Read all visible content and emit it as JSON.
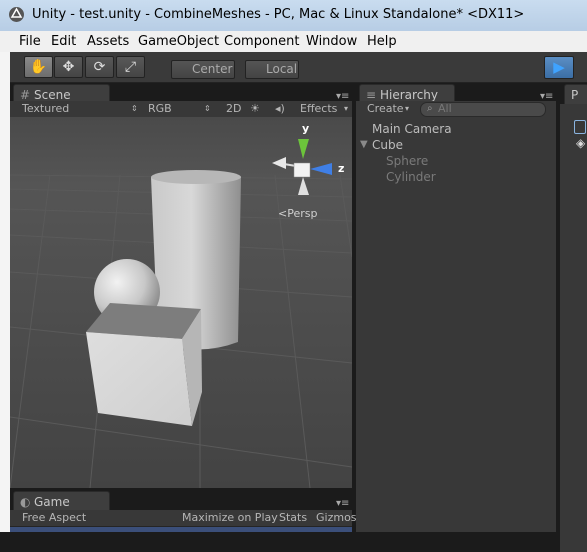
{
  "window": {
    "title": "Unity - test.unity - CombineMeshes - PC, Mac & Linux Standalone* <DX11>"
  },
  "menu": [
    "File",
    "Edit",
    "Assets",
    "GameObject",
    "Component",
    "Window",
    "Help"
  ],
  "toolbar": {
    "center_label": "Center",
    "local_label": "Local"
  },
  "scene": {
    "tab_label": "Scene",
    "shading": "Textured",
    "render": "RGB",
    "mode2d": "2D",
    "effects": "Effects",
    "persp_label": "Persp",
    "gizmo_axes": {
      "y": "y",
      "z": "z"
    },
    "colors": {
      "y_axis": "#6cc43b",
      "z_axis": "#3f7fe6",
      "background": "#474747"
    }
  },
  "hierarchy": {
    "tab_label": "Hierarchy",
    "create_label": "Create",
    "search_placeholder": "All",
    "items": [
      {
        "label": "Main Camera"
      },
      {
        "label": "Cube"
      },
      {
        "label": "Sphere"
      },
      {
        "label": "Cylinder"
      }
    ]
  },
  "project": {
    "tab_label": "P"
  },
  "game": {
    "tab_label": "Game",
    "aspect": "Free Aspect",
    "maximize": "Maximize on Play",
    "stats": "Stats",
    "gizmos": "Gizmos"
  }
}
